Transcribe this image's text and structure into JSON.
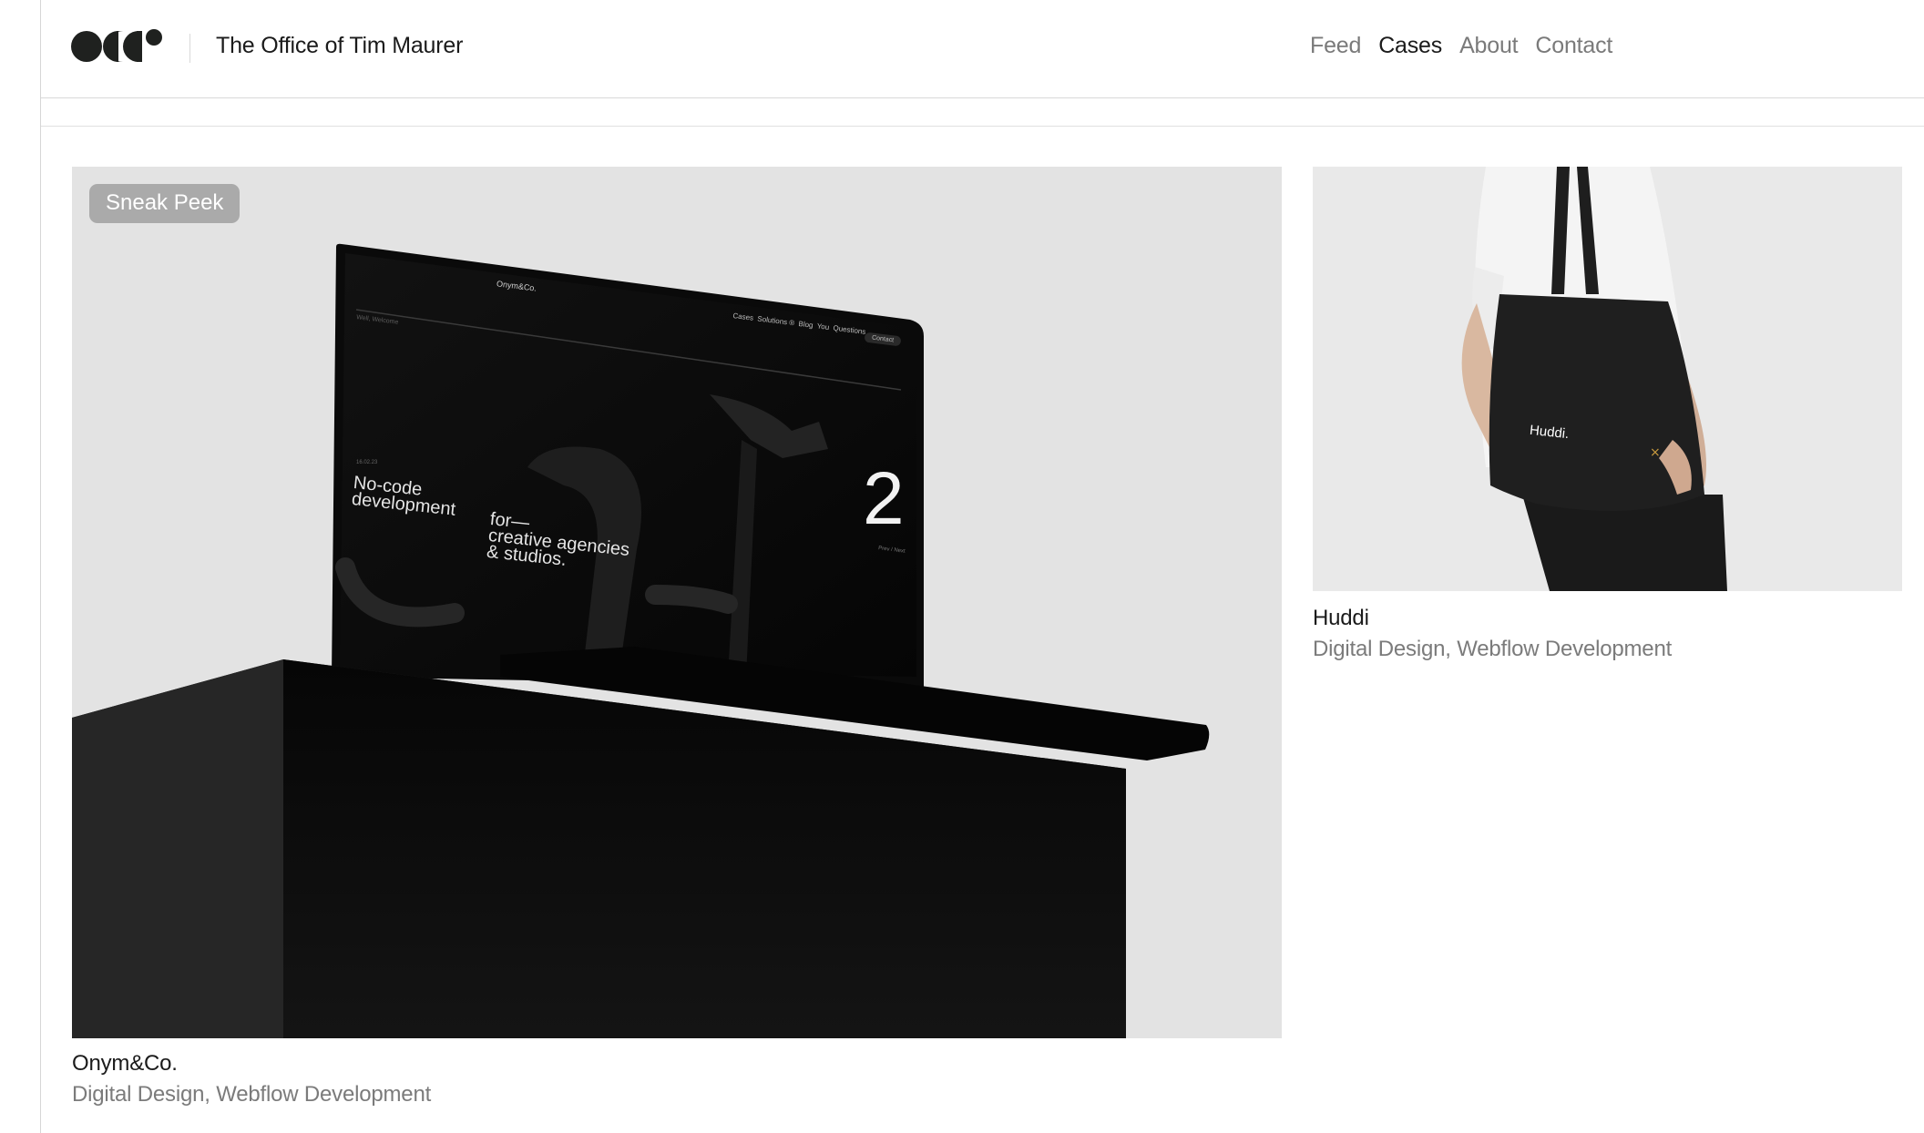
{
  "header": {
    "logo_icon": "studio-logo-icon",
    "site_title": "The Office of Tim Maurer",
    "nav": [
      {
        "label": "Feed",
        "active": false
      },
      {
        "label": "Cases",
        "active": true
      },
      {
        "label": "About",
        "active": false
      },
      {
        "label": "Contact",
        "active": false
      }
    ]
  },
  "cases": [
    {
      "badge": "Sneak Peek",
      "title": "Onym&Co.",
      "services": "Digital Design, Webflow Development",
      "image_icon": "laptop-mockup-image",
      "screen": {
        "brand": "Onym&Co.",
        "nav": "Cases  Solutions ®  Blog  You  Questions",
        "contact": "Contact",
        "welcome": "Well, Welcome",
        "date": "16.02.23",
        "headline_1": "No-code",
        "headline_2": "development",
        "sub_1": "for—",
        "sub_2": "creative agencies",
        "sub_3": "& studios.",
        "number": "2",
        "prev_next": "Prev / Next"
      }
    },
    {
      "title": "Huddi",
      "services": "Digital Design, Webflow Development",
      "image_icon": "tote-bag-image",
      "bag_label": "Huddi."
    }
  ],
  "colors": {
    "text_primary": "#1b1b1b",
    "text_secondary": "#7b7b7b",
    "badge_bg": "#a0a0a0",
    "hero_bg": "#e3e3e3"
  }
}
